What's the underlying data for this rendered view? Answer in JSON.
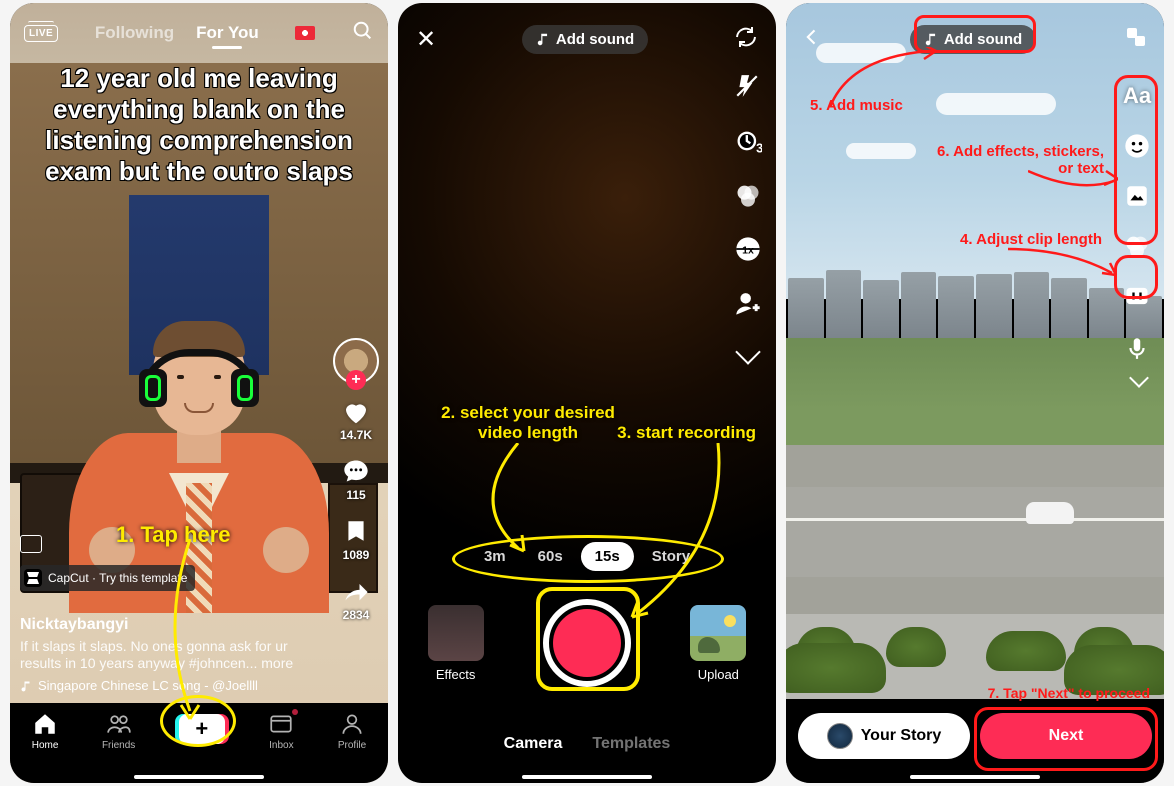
{
  "phone1": {
    "top": {
      "live": "LIVE",
      "tab_following": "Following",
      "tab_foryou": "For You"
    },
    "caption": "12 year old me leaving everything blank on the listening comprehension exam but the outro slaps",
    "rail": {
      "likes": "14.7K",
      "comments": "115",
      "saves": "1089",
      "shares": "2834"
    },
    "capcut": "CapCut · Try this template",
    "username": "Nicktaybangyi",
    "description": "If it slaps it slaps. No ones gonna ask for ur results in 10 years anyway #johncen... more",
    "music": "Singapore Chinese LC song - @Joellll",
    "tabs": {
      "home": "Home",
      "friends": "Friends",
      "inbox": "Inbox",
      "profile": "Profile"
    },
    "annotation": "1. Tap here"
  },
  "phone2": {
    "add_sound": "Add sound",
    "length": {
      "a": "3m",
      "b": "60s",
      "c": "15s",
      "d": "Story"
    },
    "effects": "Effects",
    "upload": "Upload",
    "bottom": {
      "camera": "Camera",
      "templates": "Templates"
    },
    "annotation_len": "2. select your desired video length",
    "annotation_rec": "3. start recording"
  },
  "phone3": {
    "add_sound": "Add sound",
    "story": "Your Story",
    "next": "Next",
    "a4": "4. Adjust clip length",
    "a5": "5. Add music",
    "a6": "6. Add effects, stickers, or text",
    "a7": "7. Tap \"Next\" to proceed"
  }
}
